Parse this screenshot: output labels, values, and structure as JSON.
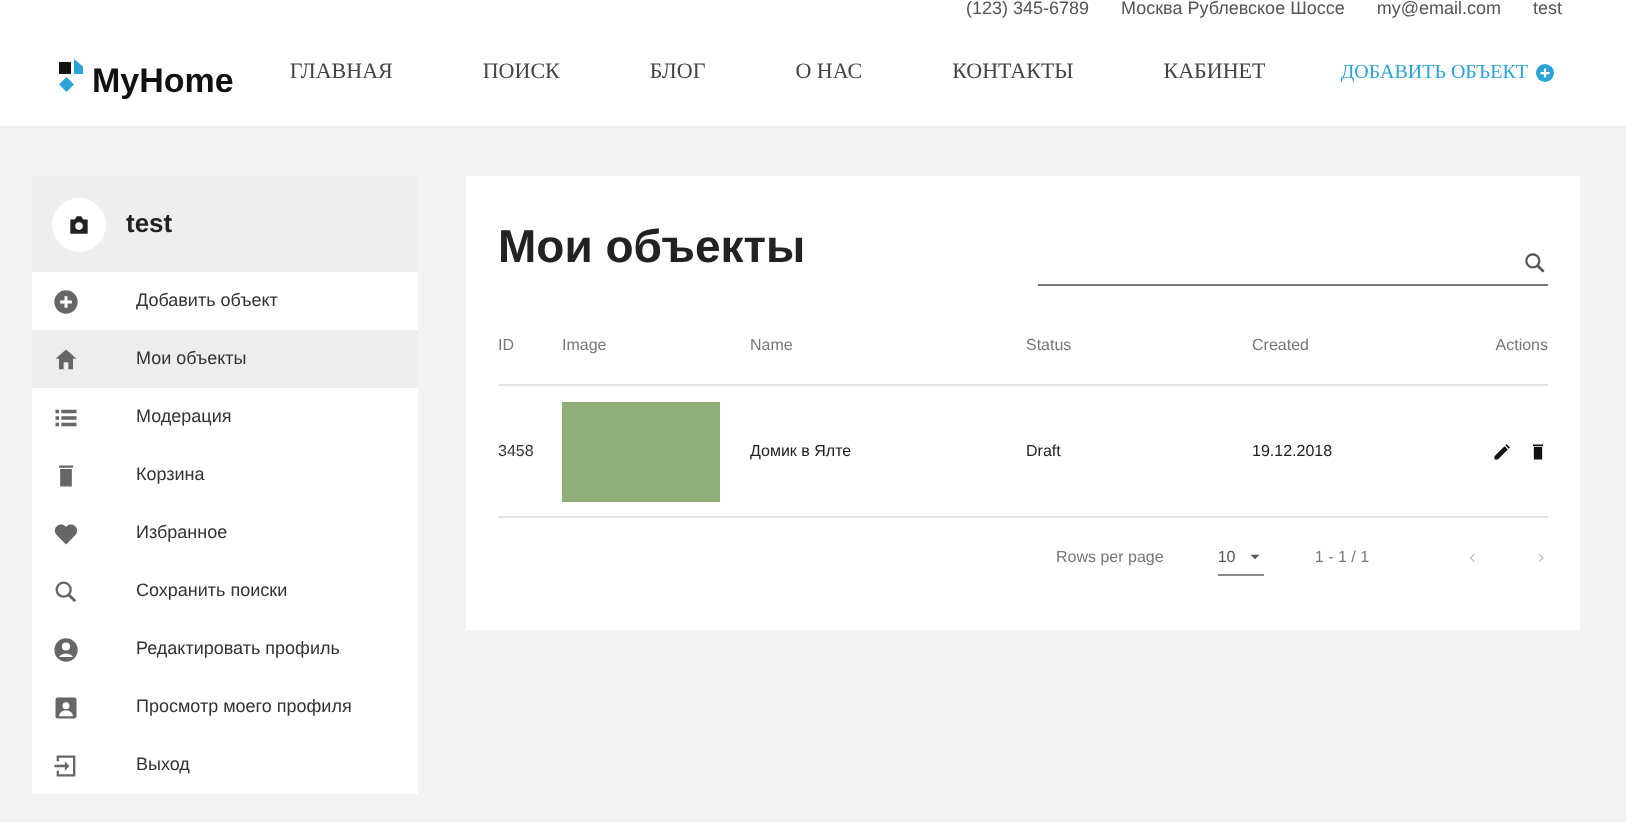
{
  "topbar": {
    "phone": "(123) 345-6789",
    "address": "Москва Рублевское Шоссе",
    "email": "my@email.com",
    "user": "test"
  },
  "nav": {
    "logo": "MyHome",
    "items": [
      "ГЛАВНАЯ",
      "ПОИСК",
      "БЛОГ",
      "О НАС",
      "КОНТАКТЫ",
      "КАБИНЕТ"
    ],
    "add": "ДОБАВИТЬ ОБЪЕКТ"
  },
  "sidebar": {
    "user": "test",
    "items": [
      {
        "kind": "add",
        "label": "Добавить объект",
        "selected": false
      },
      {
        "kind": "home",
        "label": "Мои объекты",
        "selected": true
      },
      {
        "kind": "list",
        "label": "Модерация",
        "selected": false
      },
      {
        "kind": "trash",
        "label": "Корзина",
        "selected": false
      },
      {
        "kind": "heart",
        "label": "Избранное",
        "selected": false
      },
      {
        "kind": "search",
        "label": "Сохранить поиски",
        "selected": false
      },
      {
        "kind": "person",
        "label": "Редактировать профиль",
        "selected": false
      },
      {
        "kind": "badge",
        "label": "Просмотр моего профиля",
        "selected": false
      },
      {
        "kind": "exit",
        "label": "Выход",
        "selected": false
      }
    ]
  },
  "main": {
    "title": "Мои объекты",
    "columns": [
      "ID",
      "Image",
      "Name",
      "Status",
      "Created",
      "Actions"
    ],
    "rows": [
      {
        "id": "3458",
        "name": "Домик в Ялте",
        "status": "Draft",
        "created": "19.12.2018"
      }
    ],
    "pagination": {
      "rows_per_page_label": "Rows per page",
      "rows_per_page": "10",
      "range": "1 - 1 / 1"
    }
  }
}
